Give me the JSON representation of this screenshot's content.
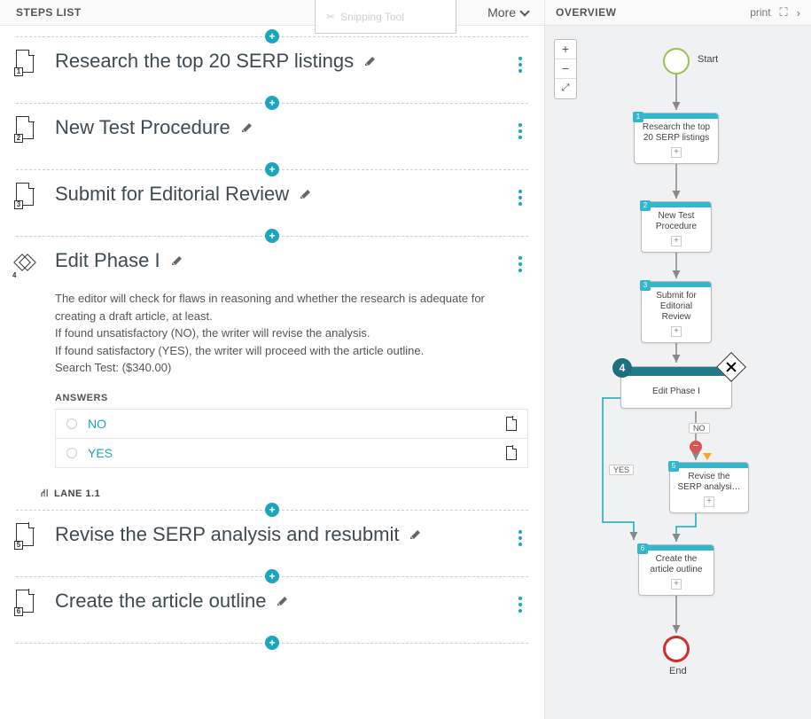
{
  "left": {
    "title": "STEPS LIST",
    "snipping_tool": "Snipping Tool",
    "more_label": "More",
    "steps": [
      {
        "num": "1",
        "title": "Research the top 20 SERP listings",
        "type": "page"
      },
      {
        "num": "2",
        "title": "New Test Procedure",
        "type": "page"
      },
      {
        "num": "3",
        "title": "Submit for Editorial Review",
        "type": "page"
      },
      {
        "num": "4",
        "title": "Edit Phase I",
        "type": "decision",
        "desc_lines": [
          "The editor will check for flaws in reasoning and whether the research is adequate for creating a draft article, at least.",
          "If found unsatisfactory (NO), the writer will revise the analysis.",
          "If found satisfactory (YES), the writer will proceed with the article outline.",
          "Search Test: ($340.00)"
        ],
        "answers_label": "ANSWERS",
        "answers": [
          "NO",
          "YES"
        ],
        "lane_label": "LANE 1.1"
      },
      {
        "num": "5",
        "title": "Revise the SERP analysis and resubmit",
        "type": "page"
      },
      {
        "num": "6",
        "title": "Create the article outline",
        "type": "page"
      }
    ]
  },
  "right": {
    "title": "OVERVIEW",
    "print_label": "print",
    "start_label": "Start",
    "end_label": "End",
    "yes": "YES",
    "no": "NO",
    "nodes": [
      {
        "num": "1",
        "label": "Research the top 20 SERP listings"
      },
      {
        "num": "2",
        "label": "New Test Procedure"
      },
      {
        "num": "3",
        "label": "Submit for Editorial Review"
      },
      {
        "num": "4",
        "label": "Edit Phase I"
      },
      {
        "num": "5",
        "label": "Revise the SERP analysi…"
      },
      {
        "num": "6",
        "label": "Create the article outline"
      }
    ]
  }
}
